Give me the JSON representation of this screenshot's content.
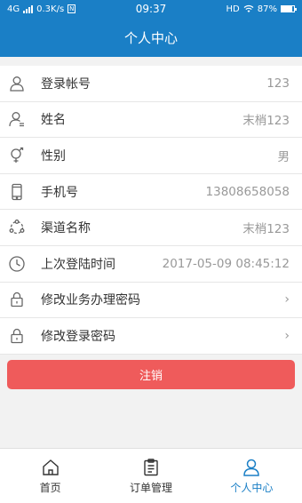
{
  "status_bar": {
    "network": "4G",
    "speed": "0.3K/s",
    "sim_badge": "N",
    "time": "09:37",
    "hd": "HD",
    "battery": "87%",
    "battery_level": 0.87
  },
  "header": {
    "title": "个人中心"
  },
  "list": {
    "items": [
      {
        "label": "登录帐号",
        "value": "123",
        "icon": "user-icon"
      },
      {
        "label": "姓名",
        "value": "末梢123",
        "icon": "user-edit-icon"
      },
      {
        "label": "性别",
        "value": "男",
        "icon": "gender-icon"
      },
      {
        "label": "手机号",
        "value": "13808658058",
        "icon": "phone-icon"
      },
      {
        "label": "渠道名称",
        "value": "末梢123",
        "icon": "channel-icon"
      },
      {
        "label": "上次登陆时间",
        "value": "2017-05-09 08:45:12",
        "icon": "clock-icon"
      },
      {
        "label": "修改业务办理密码",
        "value": "›",
        "icon": "lock-icon"
      },
      {
        "label": "修改登录密码",
        "value": "›",
        "icon": "lock-icon"
      }
    ]
  },
  "logout": {
    "label": "注销"
  },
  "tabbar": {
    "tabs": [
      {
        "label": "首页",
        "icon": "home-icon"
      },
      {
        "label": "订单管理",
        "icon": "clipboard-icon"
      },
      {
        "label": "个人中心",
        "icon": "person-icon"
      }
    ]
  },
  "colors": {
    "primary": "#1a7fc6",
    "danger": "#ef5b5b",
    "background": "#f2f2f2"
  }
}
